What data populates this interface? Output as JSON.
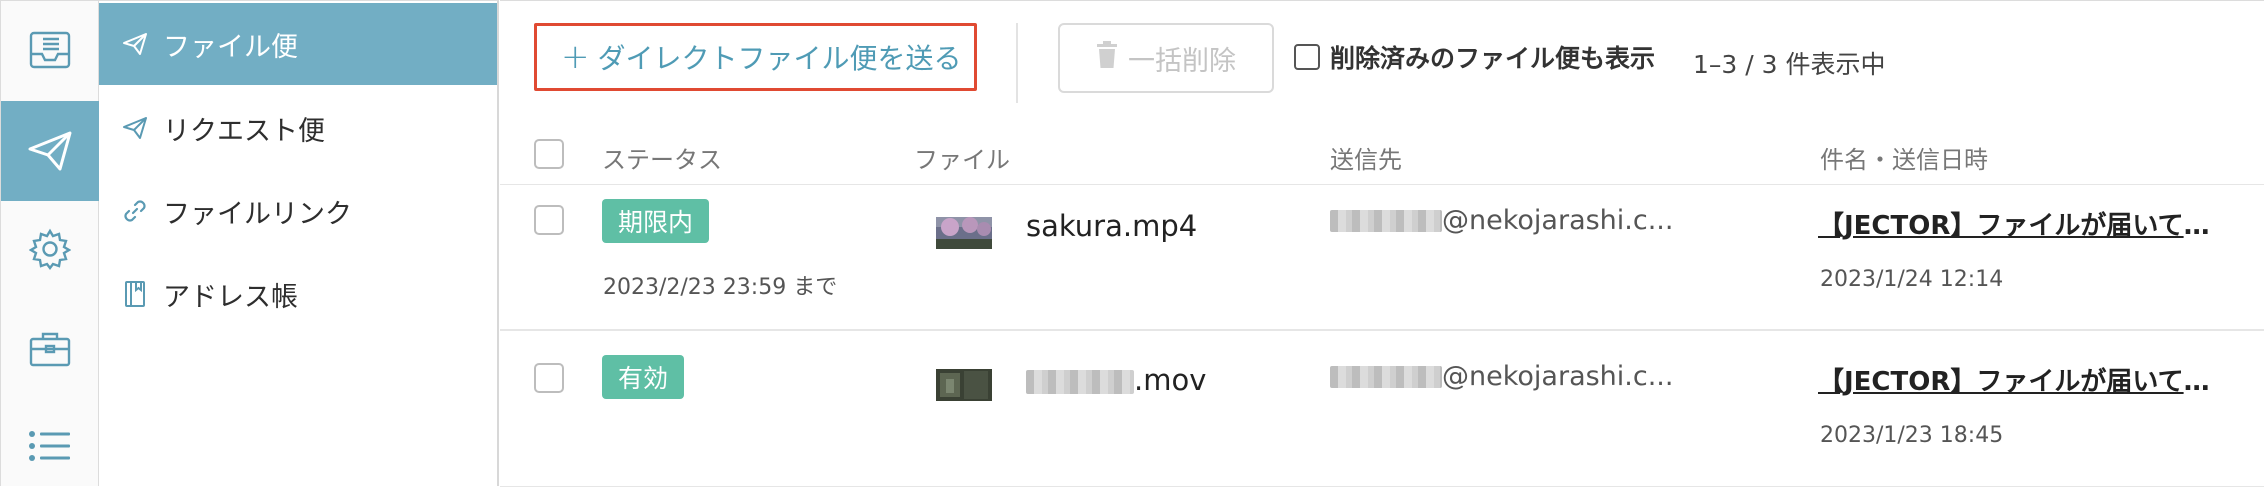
{
  "rail": {
    "items": [
      {
        "icon": "inbox-icon"
      },
      {
        "icon": "paper-plane-icon",
        "active": true
      },
      {
        "icon": "gear-icon"
      },
      {
        "icon": "briefcase-icon"
      },
      {
        "icon": "list-icon"
      }
    ]
  },
  "sidebar": {
    "items": [
      {
        "label": "ファイル便",
        "icon": "paper-plane-icon",
        "active": true
      },
      {
        "label": "リクエスト便",
        "icon": "paper-plane-icon"
      },
      {
        "label": "ファイルリンク",
        "icon": "link-icon"
      },
      {
        "label": "アドレス帳",
        "icon": "address-book-icon"
      }
    ]
  },
  "toolbar": {
    "send_direct_plus": "+",
    "send_direct_label": "ダイレクトファイル便を送る",
    "bulk_delete_label": "一括削除",
    "show_deleted_label": "削除済みのファイル便も表示",
    "count_label": "1–3 / 3 件表示中"
  },
  "table": {
    "headers": {
      "status": "ステータス",
      "file": "ファイル",
      "recipient": "送信先",
      "subject_date": "件名・送信日時"
    },
    "rows": [
      {
        "status": "期限内",
        "due": "2023/2/23 23:59 まで",
        "file_prefix": "",
        "file_name": "sakura.mp4",
        "recipient_domain": "@nekojarashi.c...",
        "subject": "【JECTOR】ファイルが届いています",
        "sent_at": "2023/1/24 12:14"
      },
      {
        "status": "有効",
        "due": "",
        "file_prefix": "",
        "file_name": ".mov",
        "recipient_domain": "@nekojarashi.c...",
        "subject": "【JECTOR】ファイルが届いています",
        "sent_at": "2023/1/23 18:45"
      }
    ]
  },
  "colors": {
    "accent": "#72aec4",
    "highlight_border": "#e04a32",
    "badge": "#5fbfa5",
    "link_text": "#4f9bb5"
  }
}
